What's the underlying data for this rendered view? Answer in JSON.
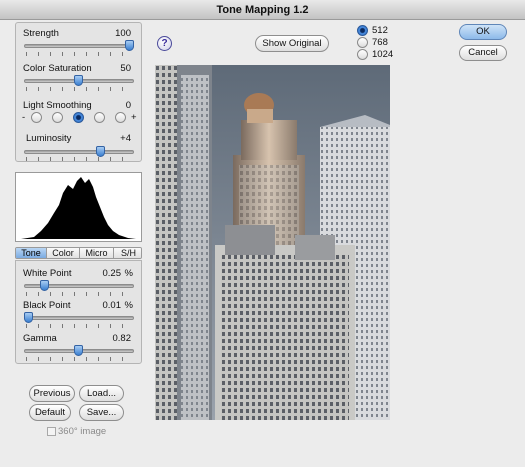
{
  "window": {
    "title": "Tone Mapping 1.2"
  },
  "sliders_top": [
    {
      "label": "Strength",
      "value": "100",
      "level": 1.0
    },
    {
      "label": "Color Saturation",
      "value": "50",
      "level": 0.5
    },
    {
      "label": "Light Smoothing",
      "value": "0"
    },
    {
      "label": "Luminosity",
      "value": "+4",
      "level": 0.62
    }
  ],
  "light_smoothing": {
    "minus": "-",
    "plus": "+",
    "selected_index": 2,
    "count": 5
  },
  "tabs": [
    "Tone",
    "Color",
    "Micro",
    "S/H"
  ],
  "active_tab": "Tone",
  "sliders_tone": [
    {
      "label": "White Point",
      "value": "0.25",
      "unit": "%",
      "level": 0.25
    },
    {
      "label": "Black Point",
      "value": "0.01",
      "unit": "%",
      "level": 0.0
    },
    {
      "label": "Gamma",
      "value": "0.82",
      "level": 0.5
    }
  ],
  "buttons": {
    "previous": "Previous",
    "load": "Load...",
    "default": "Default",
    "save": "Save...",
    "show_original": "Show Original",
    "ok": "OK",
    "cancel": "Cancel",
    "help": "?"
  },
  "checkbox_360": {
    "label": "360° image",
    "checked": false
  },
  "preview_sizes": {
    "options": [
      "512",
      "768",
      "1024"
    ],
    "selected": "512"
  }
}
